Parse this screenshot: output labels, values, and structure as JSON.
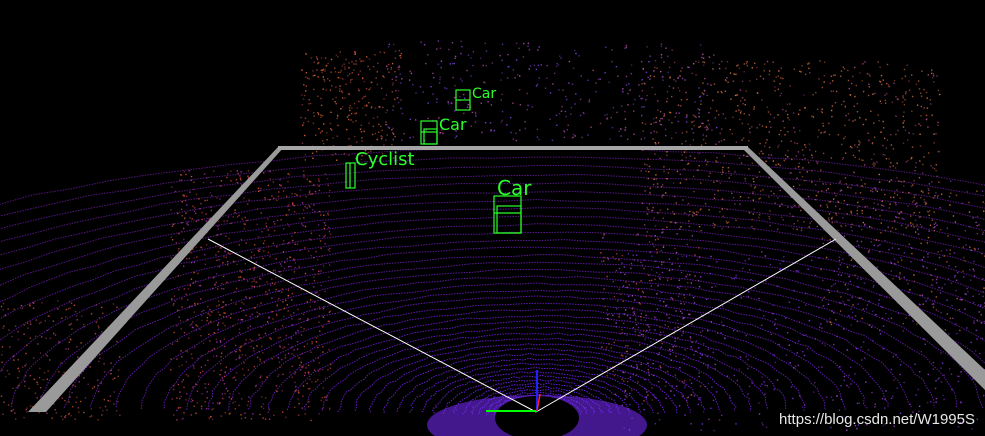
{
  "viewer": {
    "background": "#000000",
    "box_color": "#2bff2b",
    "road_plane_color": "#8c8c8c",
    "fov_line_color": "#ffffff"
  },
  "detections": [
    {
      "label": "Car"
    },
    {
      "label": "Car"
    },
    {
      "label": "Cyclist"
    },
    {
      "label": "Car"
    }
  ],
  "axes": {
    "x_color": "#00ff00",
    "y_color": "#0000ff",
    "z_color": "#ff0000"
  },
  "watermark": "https://blog.csdn.net/W1995S"
}
